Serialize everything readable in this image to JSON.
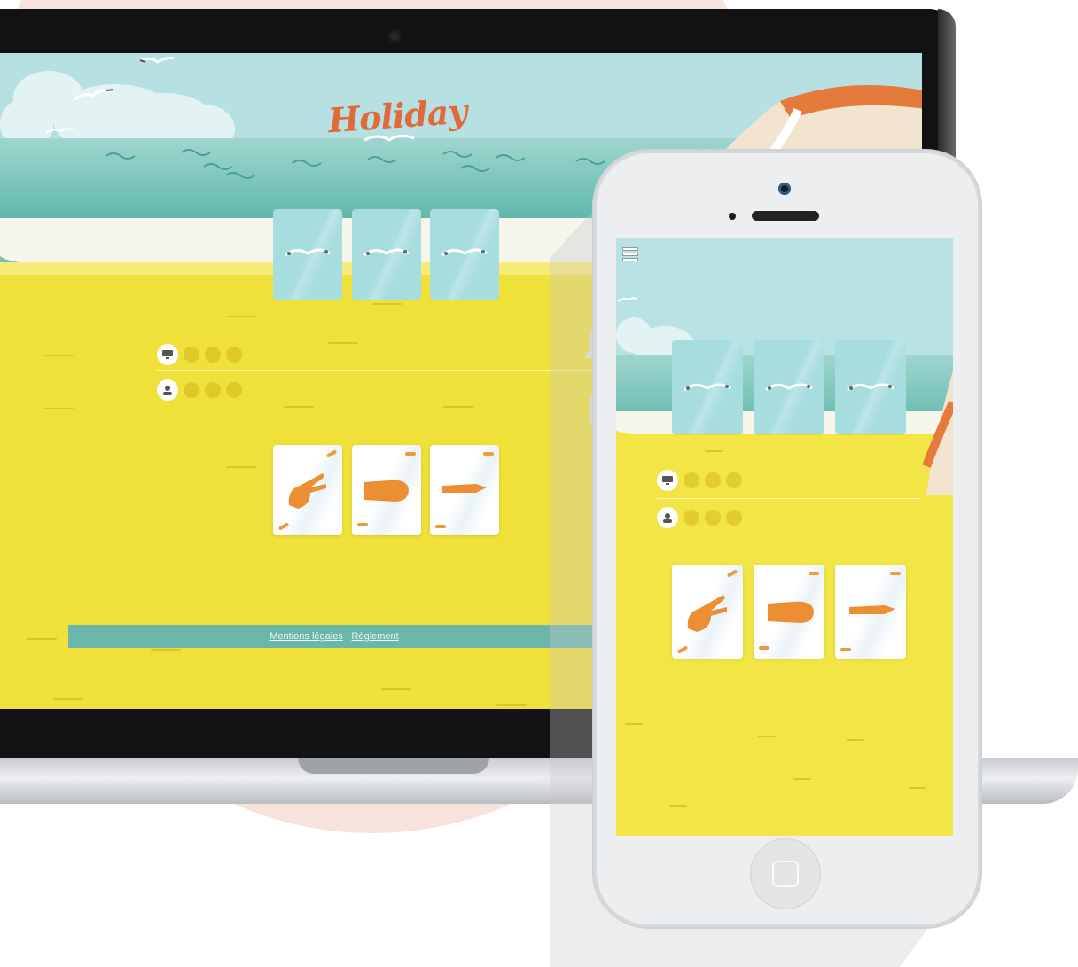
{
  "app": {
    "logo": "Holiday",
    "menu_icon": "hamburger-menu-icon"
  },
  "desktop": {
    "score_rows": [
      {
        "player_icon": "computer-icon",
        "points": 3
      },
      {
        "player_icon": "user-icon",
        "points": 3
      }
    ],
    "opponent_cards": [
      "seagull-card",
      "seagull-card",
      "seagull-card"
    ],
    "hand_cards": [
      {
        "icon": "scissors-hand-icon"
      },
      {
        "icon": "rock-hand-icon"
      },
      {
        "icon": "paper-hand-icon"
      }
    ],
    "footer": {
      "legal_link": "Mentions légales",
      "separator": "·",
      "rules_link": "Règlement"
    }
  },
  "mobile": {
    "opponent_cards": [
      "seagull-card",
      "seagull-card",
      "seagull-card"
    ],
    "score_rows": [
      {
        "player_icon": "computer-icon",
        "points": 3
      },
      {
        "player_icon": "user-icon",
        "points": 3
      }
    ],
    "hand_cards": [
      {
        "icon": "scissors-hand-icon"
      },
      {
        "icon": "rock-hand-icon"
      },
      {
        "icon": "paper-hand-icon"
      }
    ]
  },
  "colors": {
    "sky": "#b6e0e2",
    "sea": "#5fb7ab",
    "sand": "#f0e03a",
    "accent": "#e06a3a",
    "footer_bar": "#6ab6aa"
  }
}
